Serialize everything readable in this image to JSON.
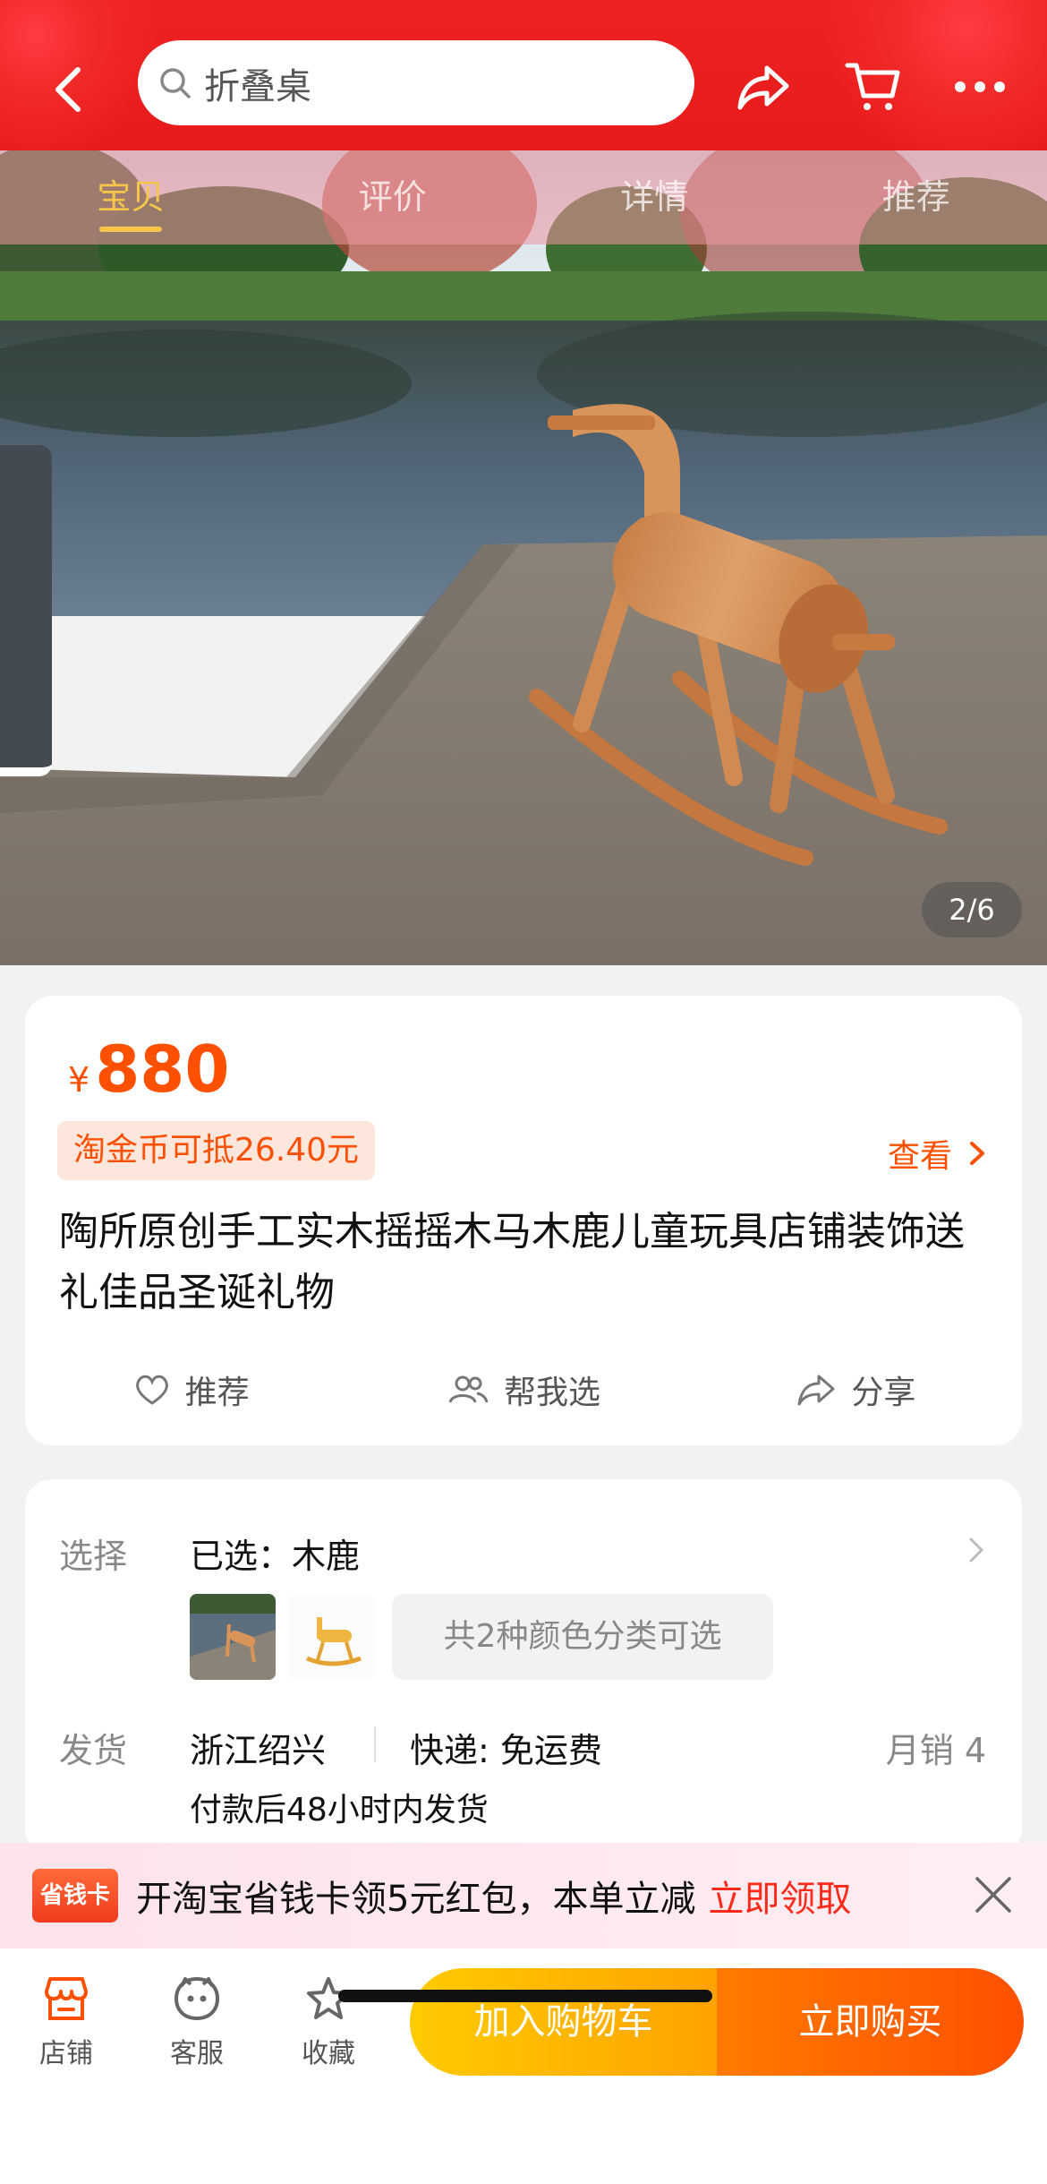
{
  "header": {
    "search_placeholder": "折叠桌",
    "icons": [
      "back-icon",
      "search-icon",
      "share-icon",
      "cart-icon",
      "more-icon"
    ]
  },
  "tabs": [
    {
      "label": "宝贝",
      "active": true
    },
    {
      "label": "评价",
      "active": false
    },
    {
      "label": "详情",
      "active": false
    },
    {
      "label": "推荐",
      "active": false
    }
  ],
  "gallery": {
    "counter": "2/6"
  },
  "product": {
    "currency": "¥",
    "price": "880",
    "coin_discount": "淘金币可抵26.40元",
    "view_label": "查看",
    "title": "陶所原创手工实木摇摇木马木鹿儿童玩具店铺装饰送礼佳品圣诞礼物",
    "actions": {
      "recommend": "推荐",
      "help_choose": "帮我选",
      "share": "分享"
    }
  },
  "options": {
    "select_label": "选择",
    "selected": "已选：木鹿",
    "colors_badge": "共2种颜色分类可选",
    "ship_label": "发货",
    "origin": "浙江绍兴",
    "shipping": "快递: 免运费",
    "sales": "月销  4",
    "ship_time": "付款后48小时内发货"
  },
  "promo": {
    "badge": "省钱卡",
    "text": "开淘宝省钱卡领5元红包，本单立减",
    "cta": "立即领取"
  },
  "bottom": {
    "store": "店铺",
    "service": "客服",
    "favorite": "收藏",
    "add_to_cart": "加入购物车",
    "buy_now": "立即购买"
  },
  "colors": {
    "brand_red": "#ee2222",
    "price_orange": "#ff5000",
    "cart_yellow": "#ffb400"
  }
}
